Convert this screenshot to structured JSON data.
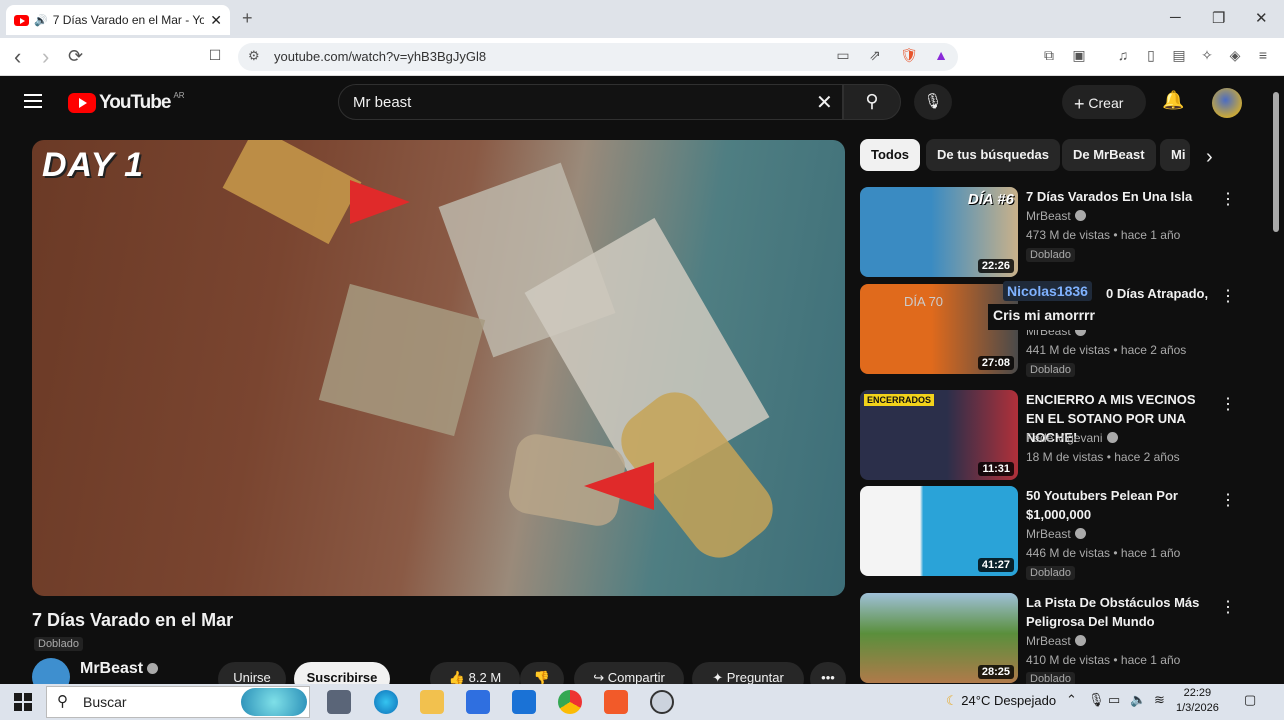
{
  "browser": {
    "tab_title": "7 Días Varado en el Mar - Yo",
    "url": "youtube.com/watch?v=yhB3BgJyGl8",
    "new_tab": "+",
    "window": {
      "minimize": "─",
      "maximize": "❐",
      "close": "✕"
    },
    "nav": {
      "back": "‹",
      "forward": "›",
      "reload": "⟳"
    }
  },
  "youtube": {
    "logo": "YouTube",
    "region": "AR",
    "search_value": "Mr beast",
    "create_label": "Crear",
    "video": {
      "overlay_text": "DAY 1",
      "title": "7 Días Varado en el Mar",
      "dubbed": "Doblado",
      "channel": "MrBeast",
      "join": "Unirse",
      "subscribe": "Suscribirse",
      "likes": "8.2 M",
      "share": "Compartir",
      "ask": "Preguntar",
      "more": "•••"
    },
    "chips": [
      "Todos",
      "De tus búsquedas",
      "De MrBeast",
      "Mi"
    ],
    "related": [
      {
        "title": "7 Días Varados En Una Isla",
        "channel": "MrBeast",
        "meta": "473 M de vistas • hace 1 año",
        "badge": "Doblado",
        "duration": "22:26",
        "thumb_text": "DÍA #6",
        "color_a": "#3a8bc2",
        "color_b": "#c9b18a"
      },
      {
        "title": "0 Días Atrapado,",
        "channel": "MrBeast",
        "meta": "441 M de vistas • hace 2 años",
        "badge": "Doblado",
        "duration": "27:08",
        "thumb_text": "DÍA 70",
        "color_a": "#e06a1c",
        "color_b": "#4a4a4a"
      },
      {
        "title": "ENCIERRO A MIS VECINOS EN EL SOTANO POR UNA NOCHE!",
        "channel": "Fede Vigevani",
        "meta": "18 M de vistas • hace 2 años",
        "badge": "",
        "duration": "11:31",
        "thumb_text": "ENCERRADOS",
        "color_a": "#2b2f4a",
        "color_b": "#b0303a"
      },
      {
        "title": "50 Youtubers Pelean Por $1,000,000",
        "channel": "MrBeast",
        "meta": "446 M de vistas • hace 1 año",
        "badge": "Doblado",
        "duration": "41:27",
        "thumb_text": "",
        "color_a": "#f4f4f4",
        "color_b": "#2aa3d8"
      },
      {
        "title": "La Pista De Obstáculos Más Peligrosa Del Mundo",
        "channel": "MrBeast",
        "meta": "410 M de vistas • hace 1 año",
        "badge": "Doblado",
        "duration": "28:25",
        "thumb_text": "",
        "color_a": "#5a8f3c",
        "color_b": "#b07a4a"
      }
    ],
    "overlay": {
      "user": "Nicolas1836",
      "message": "Cris mi amorrrr"
    }
  },
  "taskbar": {
    "search_placeholder": "Buscar",
    "weather": "24°C  Despejado",
    "time": "22:29",
    "date": "1/3/2026"
  }
}
